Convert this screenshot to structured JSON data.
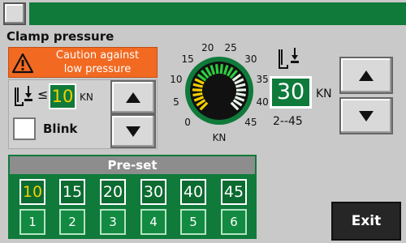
{
  "screen": {
    "title": "Clamp pressure"
  },
  "warning": {
    "text_line1": "Caution against",
    "text_line2": "low pressure",
    "icon": "warning-triangle-icon"
  },
  "threshold": {
    "comparator": "≤",
    "value": "10",
    "unit": "KN",
    "icon": "clamp-icon",
    "up_icon": "arrow-up-icon",
    "down_icon": "arrow-down-icon"
  },
  "blink": {
    "label": "Blink",
    "checked": false
  },
  "gauge": {
    "ticks": [
      "0",
      "5",
      "10",
      "15",
      "20",
      "25",
      "30",
      "35",
      "40",
      "45"
    ],
    "unit": "KN",
    "min": 0,
    "max": 45,
    "value": 30
  },
  "set_pressure": {
    "value": "30",
    "unit": "KN",
    "range": "2--45",
    "icon": "clamp-icon",
    "up_icon": "arrow-up-icon",
    "down_icon": "arrow-down-icon"
  },
  "preset": {
    "header": "Pre-set",
    "values": [
      "10",
      "15",
      "20",
      "30",
      "40",
      "45"
    ],
    "indices": [
      "1",
      "2",
      "3",
      "4",
      "5",
      "6"
    ],
    "selected_value_color": "#f3d000"
  },
  "buttons": {
    "exit": "Exit"
  },
  "colors": {
    "header_green": "#0f7a3a",
    "warning_orange": "#f26a21",
    "gauge_green": "#2ecc40",
    "gauge_yellow": "#f3d000"
  }
}
